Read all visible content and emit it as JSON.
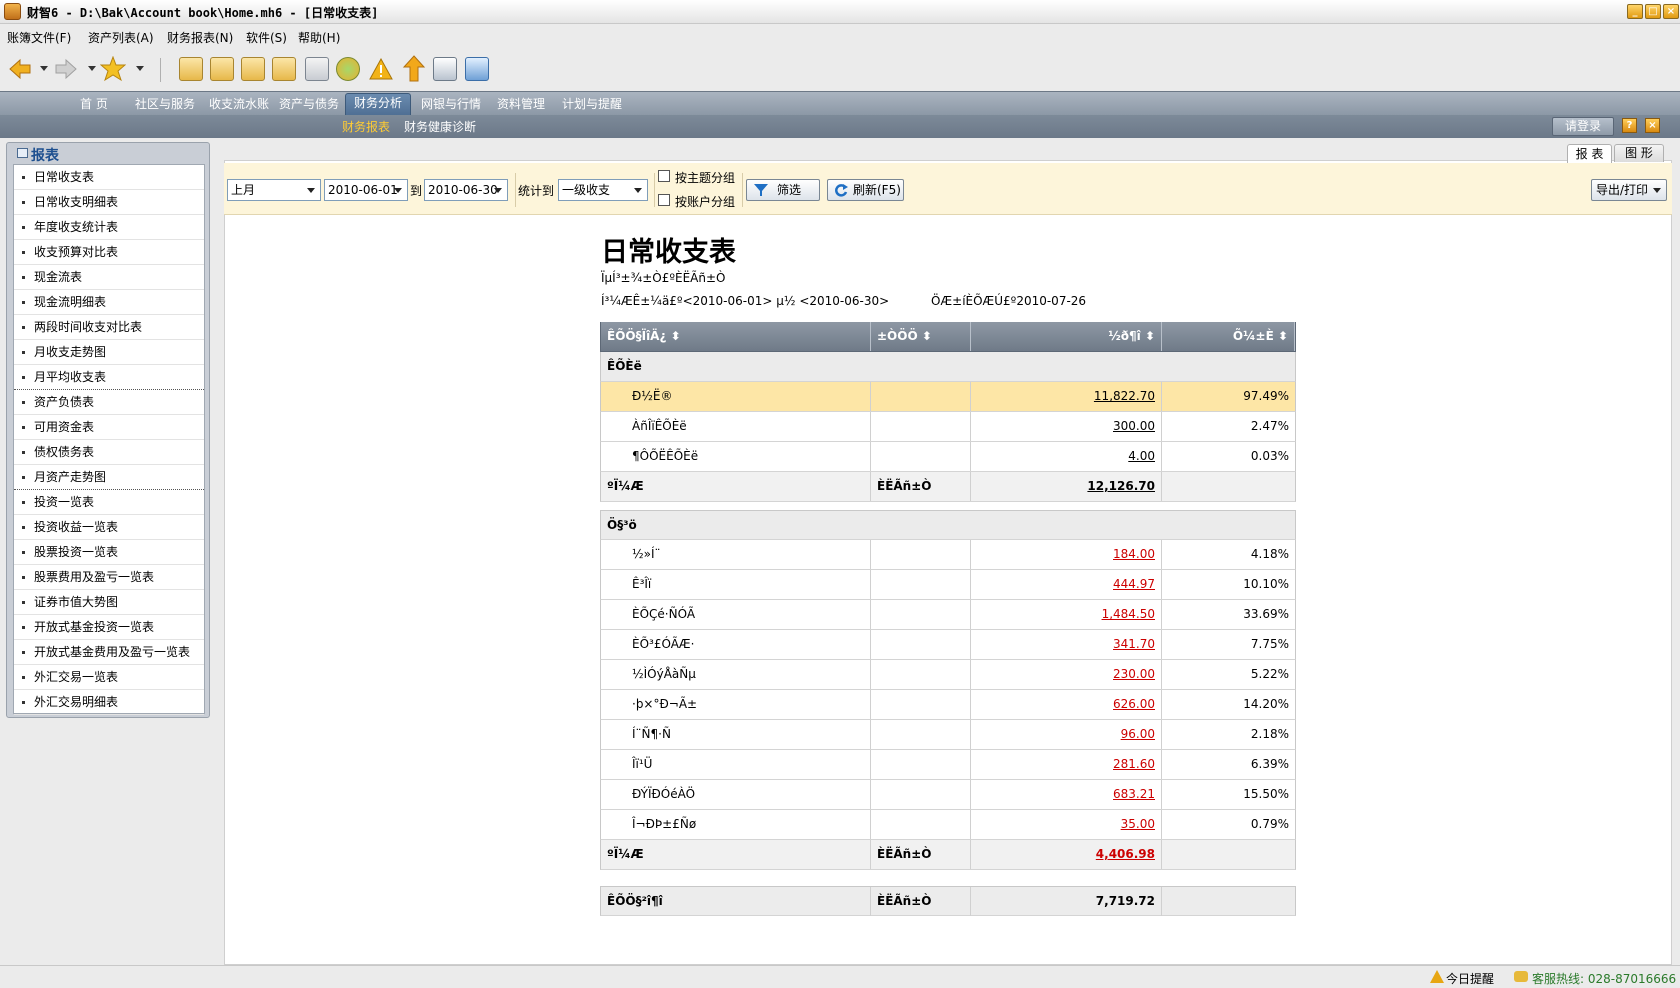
{
  "window": {
    "title": "财智6 - D:\\Bak\\Account book\\Home.mh6 - [日常收支表]"
  },
  "menu": [
    "账簿文件(F)",
    "资产列表(A)",
    "财务报表(N)",
    "软件(S)",
    "帮助(H)"
  ],
  "nav": {
    "tabs": [
      "首 页",
      "社区与服务",
      "收支流水账",
      "资产与债务",
      "财务分析",
      "网银与行情",
      "资料管理",
      "计划与提醒"
    ],
    "active": "财务分析",
    "subtabs": [
      "财务报表",
      "财务健康诊断"
    ],
    "login": "请登录",
    "help_glyph": "?",
    "close_glyph": "×"
  },
  "sidebar": {
    "title": "报表",
    "items": [
      "日常收支表",
      "日常收支明细表",
      "年度收支统计表",
      "收支预算对比表",
      "现金流表",
      "现金流明细表",
      "两段时间收支对比表",
      "月收支走势图",
      "月平均收支表",
      "资产负债表",
      "可用资金表",
      "债权债务表",
      "月资产走势图",
      "投资一览表",
      "投资收益一览表",
      "股票投资一览表",
      "股票费用及盈亏一览表",
      "证券市值大势图",
      "开放式基金投资一览表",
      "开放式基金费用及盈亏一览表",
      "外汇交易一览表",
      "外汇交易明细表"
    ]
  },
  "view_tabs": {
    "report": "报 表",
    "chart": "图 形"
  },
  "filters": {
    "period": "上月",
    "start_date": "2010-06-01",
    "to_label": "到",
    "end_date": "2010-06-30",
    "stat_label": "统计到",
    "level": "一级收支",
    "group_by_subject": "按主题分组",
    "group_by_account": "按账户分组",
    "filter_btn": "筛选",
    "refresh_btn": "刷新(F5)",
    "export_btn": "导出/打印"
  },
  "report": {
    "title": "日常收支表",
    "subtitle": "ÏµÍ³±¾±Ò£ºÈËÃñ±Ò",
    "range": "Í³¼ÆÊ±¼ä£º<2010-06-01> µ½ <2010-06-30>",
    "print_date": "ÖÆ±íÈÕÆÚ£º2010-07-26",
    "headers": [
      "ÊÕÖ§ÏîÄ¿",
      "±ÒÖÖ",
      "½ð¶î",
      "Õ¼±È"
    ],
    "income": {
      "label": "ÊÕÈë",
      "rows": [
        {
          "name": "Ð½Ë®",
          "amount": "11,822.70",
          "pct": "97.49%"
        },
        {
          "name": "ÀñÎïÊÕÈë",
          "amount": "300.00",
          "pct": "2.47%"
        },
        {
          "name": "¶ÔÕËÊÕÈë",
          "amount": "4.00",
          "pct": "0.03%"
        }
      ],
      "total_label": "ºÏ¼Æ",
      "currency": "ÈËÃñ±Ò",
      "total": "12,126.70"
    },
    "expense": {
      "label": "Ö§³ö",
      "rows": [
        {
          "name": "½»Í¨",
          "amount": "184.00",
          "pct": "4.18%"
        },
        {
          "name": "Ê³Îï",
          "amount": "444.97",
          "pct": "10.10%"
        },
        {
          "name": "ÈÕÇé·ÑÓÃ",
          "amount": "1,484.50",
          "pct": "33.69%"
        },
        {
          "name": "ÈÕ³£ÓÃÆ·",
          "amount": "341.70",
          "pct": "7.75%"
        },
        {
          "name": "½ÌÓýÅàÑµ",
          "amount": "230.00",
          "pct": "5.22%"
        },
        {
          "name": "·þ×°Ð¬Ã±",
          "amount": "626.00",
          "pct": "14.20%"
        },
        {
          "name": "Í¨Ñ¶·Ñ",
          "amount": "96.00",
          "pct": "2.18%"
        },
        {
          "name": "Îï¹Ü",
          "amount": "281.60",
          "pct": "6.39%"
        },
        {
          "name": "ÐÝÏÐÓéÀÖ",
          "amount": "683.21",
          "pct": "15.50%"
        },
        {
          "name": "Î¬ÐÞ±£Ñø",
          "amount": "35.00",
          "pct": "0.79%"
        }
      ],
      "total_label": "ºÏ¼Æ",
      "currency": "ÈËÃñ±Ò",
      "total": "4,406.98"
    },
    "net": {
      "label": "ÊÕÖ§²î¶î",
      "currency": "ÈËÃñ±Ò",
      "amount": "7,719.72"
    }
  },
  "status": {
    "reminder": "今日提醒",
    "hotline": "客服热线: 028-87016666"
  }
}
